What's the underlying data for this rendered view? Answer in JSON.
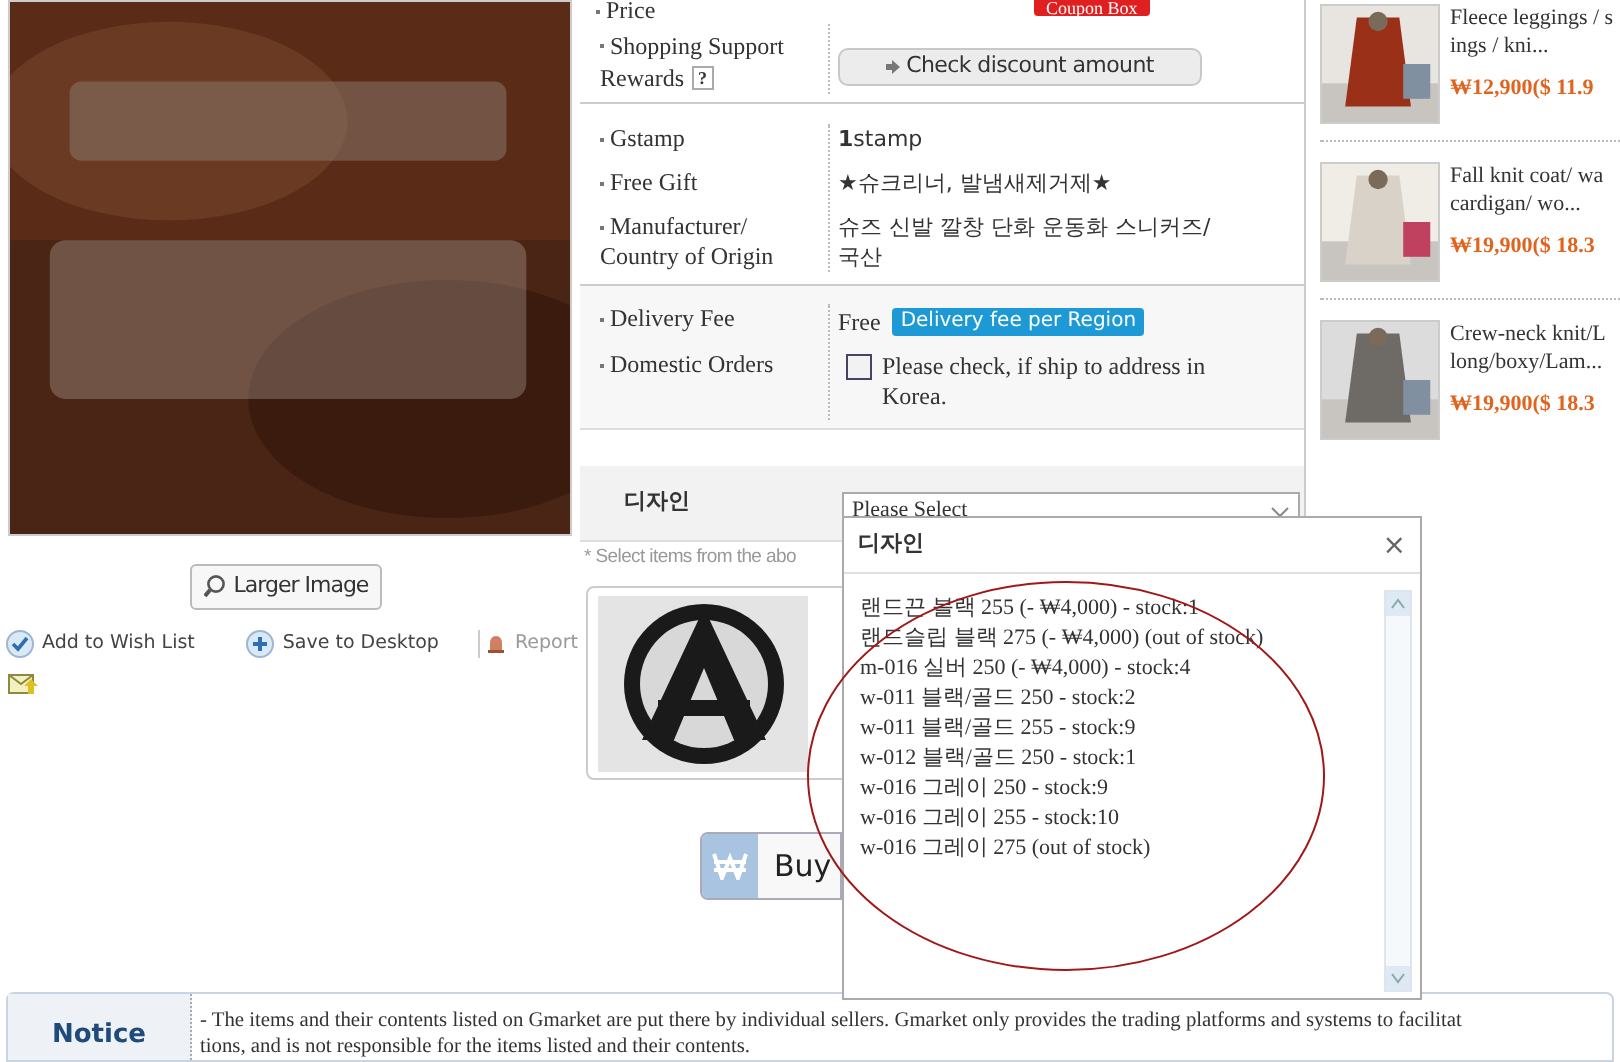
{
  "price": {
    "label": "Price",
    "coupon": "Coupon Box"
  },
  "rewards": {
    "label_lines": [
      "Shopping Support",
      "Rewards"
    ],
    "help": "?",
    "button": "Check discount amount"
  },
  "details": [
    {
      "label": "Gstamp",
      "value": "**1**stamp"
    },
    {
      "label": "Free Gift",
      "value": "★슈크리너, 발냄새제거제★"
    },
    {
      "label": "Manufacturer/ Country of Origin",
      "value": "슈즈 신발 깔창 단화 운동화 스니커즈/ 국산"
    }
  ],
  "delivery": {
    "label": "Delivery Fee",
    "value": "Free",
    "badge": "Delivery fee per Region"
  },
  "domestic": {
    "label": "Domestic Orders",
    "checked": false,
    "text": "Please check, if ship to address in Korea."
  },
  "option": {
    "label": "디자인",
    "select": "Please Select",
    "hint": "* Select items from the abo"
  },
  "larger_image": "Larger Image",
  "actions": [
    {
      "kind": "wish",
      "label": "Add to Wish List"
    },
    {
      "kind": "desktop",
      "label": "Save to Desktop"
    },
    {
      "kind": "report",
      "label": "Report"
    }
  ],
  "buy": "Buy",
  "popup": {
    "title": "디자인",
    "close": "×",
    "items": [
      "랜드끈 블랙 255 (- ₩4,000) - stock:1",
      "랜드슬립 블랙 275 (- ₩4,000) (out of stock)",
      "m-016 실버 250 (- ₩4,000) - stock:4",
      "w-011 블랙/골드 250 - stock:2",
      "w-011 블랙/골드 255 - stock:9",
      "w-012 블랙/골드 250 - stock:1",
      "w-016 그레이 250 - stock:9",
      "w-016 그레이 255 - stock:10",
      "w-016 그레이 275 (out of stock)"
    ]
  },
  "side_items": [
    {
      "lines": [
        "Fleece leggings / s",
        "ings / kni..."
      ],
      "price": "₩12,900($ 11.9"
    },
    {
      "lines": [
        "Fall knit coat/ wa",
        "cardigan/ wo..."
      ],
      "price": "₩19,900($ 18.3"
    },
    {
      "lines": [
        "Crew-neck knit/L",
        "long/boxy/Lam..."
      ],
      "price": "₩19,900($ 18.3"
    }
  ],
  "notice": {
    "label": "Notice",
    "lines": [
      "- The items and their contents listed on Gmarket are put there by individual sellers. Gmarket only provides the trading platforms and systems to facilitat",
      "tions, and is not responsible for the items listed and their contents."
    ]
  }
}
